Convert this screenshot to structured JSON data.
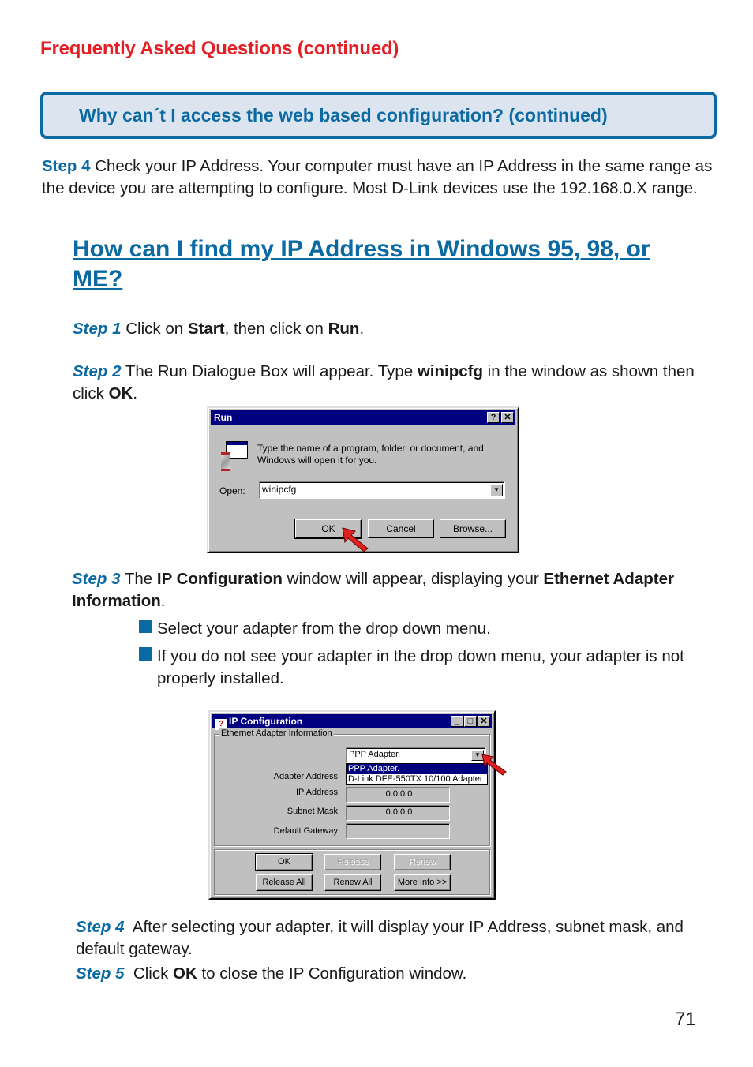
{
  "page": {
    "section_title": "Frequently Asked Questions (continued)",
    "question_box": "Why can´t I access the web based configuration? (continued)",
    "page_number": "71"
  },
  "intro_step": {
    "label": "Step 4",
    "text": " Check your IP Address. Your computer must have an IP Address in the same range as the device you are attempting to configure. Most D-Link devices use the 192.168.0.X range."
  },
  "heading": "How can I find my IP Address in Windows 95, 98, or ME?",
  "steps": {
    "step1": {
      "label": "Step 1",
      "t1": " Click on ",
      "b1": "Start",
      "t2": ", then click on ",
      "b2": "Run",
      "t3": "."
    },
    "step2": {
      "label": "Step 2",
      "t1": " The Run Dialogue Box will appear. Type ",
      "b1": "winipcfg",
      "t2": " in the window as shown then click ",
      "b2": "OK",
      "t3": "."
    },
    "step3": {
      "label": "Step 3",
      "t1": " The ",
      "b1": "IP Configuration",
      "t2": " window will appear, displaying your ",
      "b2": "Ethernet Adapter Information",
      "t3": ".",
      "bullets": [
        "Select your adapter from the drop down menu.",
        "If you do not see your adapter in the drop down menu, your adapter is not properly installed."
      ]
    },
    "step4": {
      "label": "Step 4",
      "text": "  After selecting your adapter, it will display your IP Address, subnet mask, and default gateway."
    },
    "step5": {
      "label": "Step 5",
      "t1": "  Click ",
      "b1": "OK",
      "t2": " to close the IP Configuration window."
    }
  },
  "run_dialog": {
    "title": "Run",
    "help_btn": "?",
    "close_btn": "✕",
    "prompt": "Type the name of a program, folder, or document, and Windows will open it for you.",
    "open_label": "Open:",
    "open_value": "winipcfg",
    "ok": "OK",
    "cancel": "Cancel",
    "browse": "Browse..."
  },
  "ipconfig": {
    "title": "IP Configuration",
    "group_title": "Ethernet  Adapter Information",
    "selected_adapter": "PPP Adapter.",
    "dropdown_options": [
      "PPP Adapter.",
      "D-Link DFE-550TX 10/100 Adapter"
    ],
    "fields": [
      {
        "label": "Adapter Address",
        "value": ""
      },
      {
        "label": "IP Address",
        "value": "0.0.0.0"
      },
      {
        "label": "Subnet Mask",
        "value": "0.0.0.0"
      },
      {
        "label": "Default Gateway",
        "value": ""
      }
    ],
    "buttons": {
      "ok": "OK",
      "release": "Release",
      "renew": "Renew",
      "release_all": "Release All",
      "renew_all": "Renew All",
      "more_info": "More Info >>"
    }
  },
  "colors": {
    "accent_blue": "#0a6aa1",
    "title_red": "#e31e24",
    "box_fill": "#dce5ef"
  }
}
